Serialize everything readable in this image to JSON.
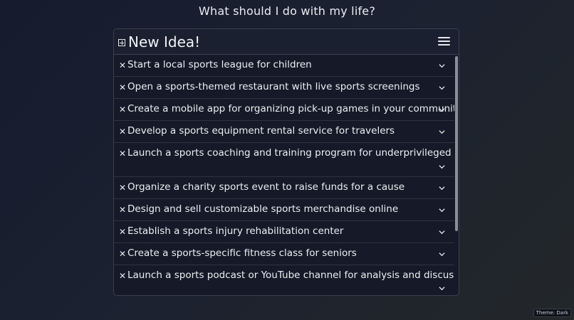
{
  "page": {
    "title": "What should I do with my life?"
  },
  "panel": {
    "new_idea_label": "New Idea!",
    "ideas": [
      "Start a local sports league for children",
      "Open a sports-themed restaurant with live sports screenings",
      "Create a mobile app for organizing pick-up games in your community",
      "Develop a sports equipment rental service for travelers",
      "Launch a sports coaching and training program for underprivileged youth",
      "Organize a charity sports event to raise funds for a cause",
      "Design and sell customizable sports merchandise online",
      "Establish a sports injury rehabilitation center",
      "Create a sports-specific fitness class for seniors",
      "Launch a sports podcast or YouTube channel for analysis and discussions"
    ]
  },
  "theme": {
    "label": "Theme: Dark"
  },
  "colors": {
    "background": "#1b2130",
    "panel": "#161a28",
    "text": "#eceef2",
    "scrollbar": "#8a8f99"
  }
}
